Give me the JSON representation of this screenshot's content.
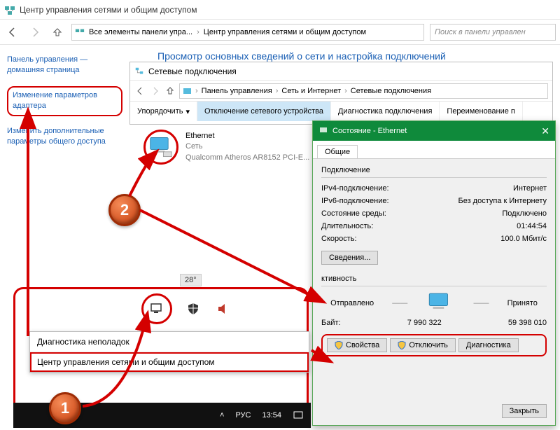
{
  "titlebar": {
    "title": "Центр управления сетями и общим доступом"
  },
  "nav": {
    "crumb1": "Все элементы панели упра...",
    "crumb2": "Центр управления сетями и общим доступом",
    "search_ph": "Поиск в панели управлен"
  },
  "sidebar": {
    "home": "Панель управления — домашняя страница",
    "adapter": "Изменение параметров адаптера",
    "sharing": "Изменить дополнительные параметры общего доступа"
  },
  "content": {
    "header": "Просмотр основных сведений о сети и настройка подключений"
  },
  "inner": {
    "title": "Сетевые подключения",
    "crumb1": "Панель управления",
    "crumb2": "Сеть и Интернет",
    "crumb3": "Сетевые подключения",
    "tb_organize": "Упорядочить",
    "tb_disable": "Отключение сетевого устройства",
    "tb_diag": "Диагностика подключения",
    "tb_rename": "Переименование п"
  },
  "eth": {
    "name": "Ethernet",
    "net": "Сеть",
    "adapter": "Qualcomm Atheros AR8152 PCI-E..."
  },
  "status": {
    "title": "Состояние - Ethernet",
    "tab": "Общие",
    "group1": "Подключение",
    "ipv4_l": "IPv4-подключение:",
    "ipv4_v": "Интернет",
    "ipv6_l": "IPv6-подключение:",
    "ipv6_v": "Без доступа к Интернету",
    "media_l": "Состояние среды:",
    "media_v": "Подключено",
    "dur_l": "Длительность:",
    "dur_v": "01:44:54",
    "spd_l": "Скорость:",
    "spd_v": "100.0 Мбит/с",
    "details": "Сведения...",
    "group2": "ктивность",
    "sent": "Отправлено",
    "recv": "Принято",
    "bytes_l": "Байт:",
    "bytes_sent": "7 990 322",
    "bytes_recv": "59 398 010",
    "props": "Свойства",
    "disable": "Отключить",
    "diag": "Диагностика",
    "close": "Закрыть"
  },
  "tray": {
    "ctx1": "Диагностика неполадок",
    "ctx2": "Центр управления сетями и общим доступом",
    "weather": "28°",
    "lang": "РУС",
    "time": "13:54"
  },
  "badges": {
    "one": "1",
    "two": "2"
  }
}
